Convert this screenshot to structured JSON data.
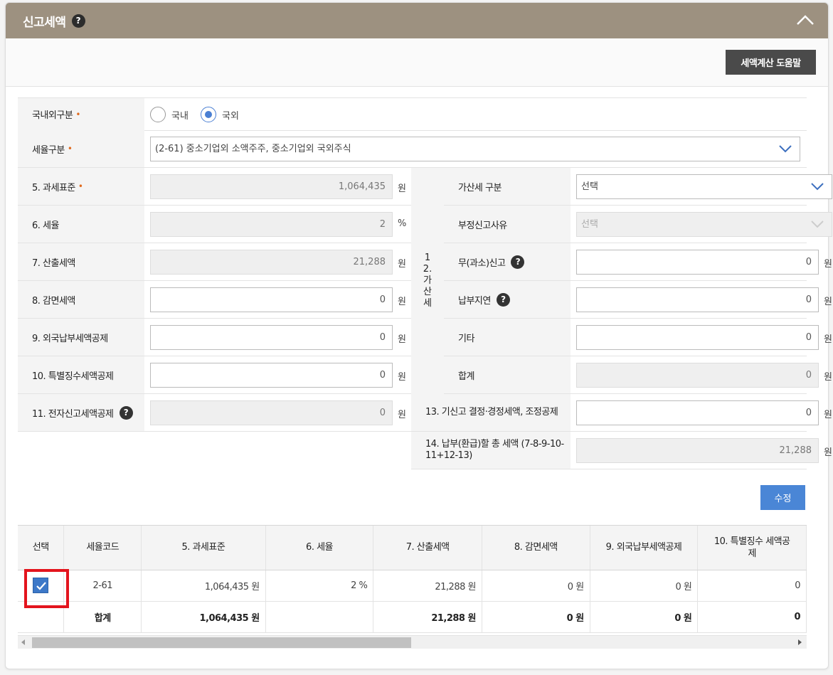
{
  "header": {
    "title": "신고세액",
    "help_icon": "?"
  },
  "toolbar": {
    "help_button": "세액계산 도움말"
  },
  "form": {
    "domestic": {
      "label": "국내외구분",
      "options": [
        "국내",
        "국외"
      ],
      "selected": "국외"
    },
    "tax_type": {
      "label": "세율구분",
      "value": "(2-61) 중소기업외 소액주주, 중소기업외 국외주식"
    },
    "rows": [
      {
        "label": "5. 과세표준",
        "value": "1,064,435",
        "unit": "원"
      },
      {
        "label": "6. 세율",
        "value": "2",
        "unit": "%"
      },
      {
        "label": "7. 산출세액",
        "value": "21,288",
        "unit": "원"
      },
      {
        "label": "8. 감면세액",
        "value": "0",
        "unit": "원"
      },
      {
        "label": "9. 외국납부세액공제",
        "value": "0",
        "unit": "원"
      },
      {
        "label": "10. 특별징수세액공제",
        "value": "0",
        "unit": "원"
      },
      {
        "label": "11. 전자신고세액공제",
        "value": "0",
        "unit": "원"
      }
    ],
    "gasanse": {
      "group_label": "12. 가 산 세",
      "type": {
        "label": "가산세 구분",
        "value": "선택"
      },
      "reason": {
        "label": "부정신고사유",
        "value": "선택"
      },
      "underreport": {
        "label": "무(과소)신고",
        "value": "0",
        "unit": "원"
      },
      "late_payment": {
        "label": "납부지연",
        "value": "0",
        "unit": "원"
      },
      "other": {
        "label": "기타",
        "value": "0",
        "unit": "원"
      },
      "total": {
        "label": "합계",
        "value": "0",
        "unit": "원"
      }
    },
    "row13": {
      "label": "13. 기신고 결정·경정세액, 조정공제",
      "value": "0",
      "unit": "원"
    },
    "row14": {
      "label": "14. 납부(환급)할 총 세액 (7-8-9-10-11+12-13)",
      "value": "21,288",
      "unit": "원"
    }
  },
  "edit_button": "수정",
  "table": {
    "headers": [
      "선택",
      "세율코드",
      "5. 과세표준",
      "6. 세율",
      "7. 산출세액",
      "8. 감면세액",
      "9. 외국납부세액공제",
      "10. 특별징수 세액공제"
    ],
    "rows": [
      {
        "checked": true,
        "code": "2-61",
        "base": "1,064,435 원",
        "rate": "2 %",
        "calc": "21,288 원",
        "reduction": "0 원",
        "foreign": "0 원",
        "special": "0"
      }
    ],
    "sum": {
      "label": "합계",
      "base": "1,064,435 원",
      "rate": "",
      "calc": "21,288 원",
      "reduction": "0 원",
      "foreign": "0 원",
      "special": "0"
    }
  },
  "colors": {
    "header": "#9d9180",
    "accent": "#4a86d6",
    "highlight": "#e3141d"
  }
}
